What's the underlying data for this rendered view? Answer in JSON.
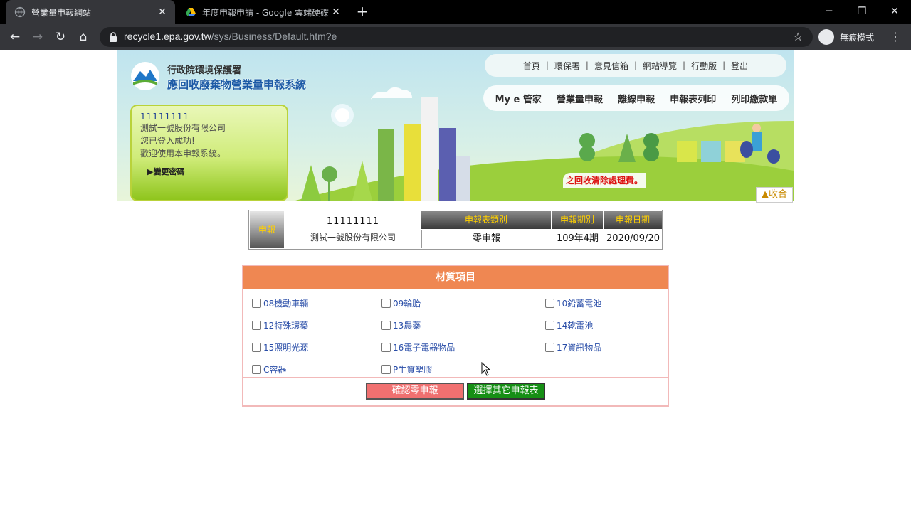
{
  "browser": {
    "tabs": [
      {
        "title": "營業量申報網站",
        "active": true
      },
      {
        "title": "年度申報申請 - Google 雲端硬碟",
        "active": false
      }
    ],
    "url_host": "recycle1.epa.gov.tw",
    "url_path": "/sys/Business/Default.htm?e",
    "incognito_label": "無痕模式"
  },
  "header": {
    "org_name": "行政院環境保護署",
    "system_name": "應回收廢棄物營業量申報系統",
    "top_links": [
      "首頁",
      "環保署",
      "意見信箱",
      "網站導覽",
      "行動版",
      "登出"
    ],
    "main_links": [
      "My e 管家",
      "營業量申報",
      "離線申報",
      "申報表列印",
      "列印繳款單"
    ],
    "marquee_text": "之回收清除處理費。",
    "collapse_label": "▲收合"
  },
  "user": {
    "id": "11111111",
    "company": "測試一號股份有限公司",
    "login_msg": "您已登入成功!",
    "welcome_msg": "歡迎使用本申報系統。",
    "change_password": "▶變更密碼"
  },
  "report_info": {
    "label": "申報",
    "company_id": "11111111",
    "company_name": "測試一號股份有限公司",
    "headers": [
      "申報表類別",
      "申報期別",
      "申報日期"
    ],
    "values": [
      "零申報",
      "109年4期",
      "2020/09/20"
    ]
  },
  "materials": {
    "title": "材質項目",
    "items": [
      {
        "label": "08機動車輛",
        "checked": false
      },
      {
        "label": "09輪胎",
        "checked": false
      },
      {
        "label": "10鉛蓄電池",
        "checked": false
      },
      {
        "label": "12特殊環藥",
        "checked": false
      },
      {
        "label": "13農藥",
        "checked": false
      },
      {
        "label": "14乾電池",
        "checked": false
      },
      {
        "label": "15照明光源",
        "checked": false
      },
      {
        "label": "16電子電器物品",
        "checked": false
      },
      {
        "label": "17資訊物品",
        "checked": false
      },
      {
        "label": "C容器",
        "checked": false
      },
      {
        "label": "P生質塑膠",
        "checked": false
      }
    ],
    "confirm_button": "確認零申報",
    "other_button": "選擇其它申報表"
  },
  "colors": {
    "material_header": "#ef8752",
    "confirm_button": "#f07070",
    "other_button": "#168f15",
    "panel_border": "#f2b9b9"
  }
}
